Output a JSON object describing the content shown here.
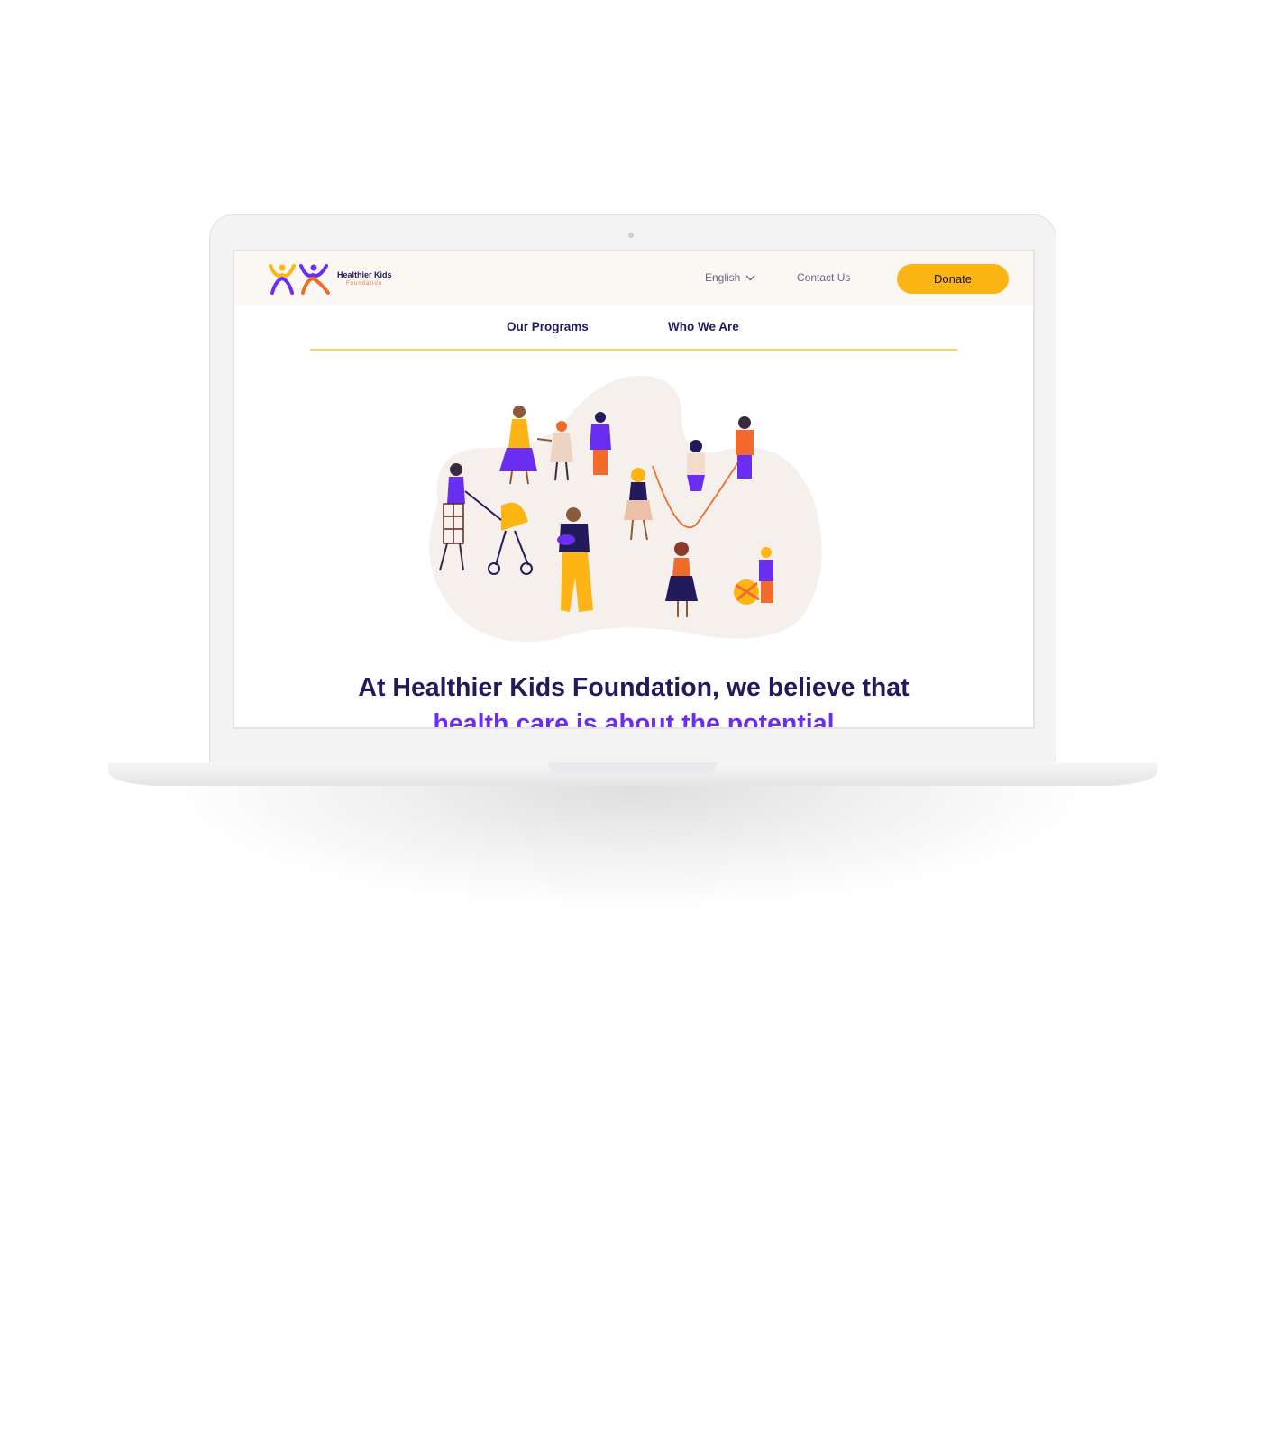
{
  "header": {
    "brand_name": "Healthier Kids",
    "brand_sub": "Foundation",
    "language": "English",
    "contact_label": "Contact Us",
    "donate_label": "Donate"
  },
  "nav": {
    "items": [
      {
        "label": "Our Programs"
      },
      {
        "label": "Who We Are"
      }
    ]
  },
  "hero": {
    "headline_line1": "At Healthier Kids Foundation, we believe that",
    "headline_line2": "health care is about the potential"
  },
  "colors": {
    "accent": "#fdb515",
    "brand_dark": "#231a5c",
    "purple": "#6a2ef0",
    "orange": "#f26b2a",
    "header_bg": "#fbf7f3"
  },
  "icons": [
    "healthier-kids-logo",
    "chevron-down-icon",
    "hero-people-illustration"
  ]
}
